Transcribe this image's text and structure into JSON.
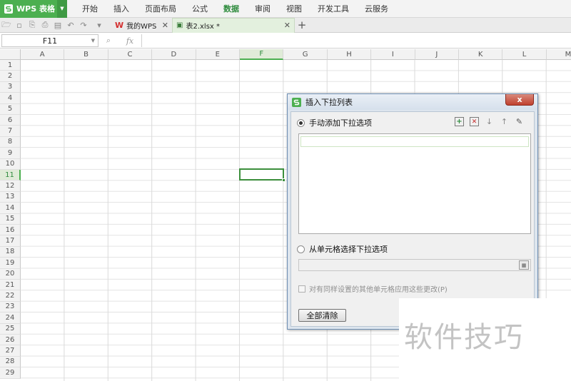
{
  "app": {
    "name": "WPS 表格"
  },
  "menu": [
    "开始",
    "插入",
    "页面布局",
    "公式",
    "数据",
    "审阅",
    "视图",
    "开发工具",
    "云服务"
  ],
  "menu_active": "数据",
  "tabs": {
    "home_label": "我的WPS",
    "doc_label": "表2.xlsx *"
  },
  "formula_bar": {
    "cell_ref": "F11",
    "fx_label": "fx",
    "value": ""
  },
  "grid": {
    "columns": [
      "A",
      "B",
      "C",
      "D",
      "E",
      "F",
      "G",
      "H",
      "I",
      "J",
      "K",
      "L",
      "M"
    ],
    "rows": [
      "1",
      "2",
      "3",
      "4",
      "5",
      "6",
      "7",
      "8",
      "9",
      "10",
      "11",
      "12",
      "13",
      "14",
      "15",
      "16",
      "17",
      "18",
      "19",
      "20",
      "21",
      "22",
      "23",
      "24",
      "25",
      "26",
      "27",
      "28",
      "29"
    ],
    "selected_column": "F",
    "selected_row": "11"
  },
  "dialog": {
    "title": "插入下拉列表",
    "close_label": "x",
    "manual_label": "手动添加下拉选项",
    "manual_selected": true,
    "option_values": [
      ""
    ],
    "range_label": "从单元格选择下拉选项",
    "range_value": "",
    "apply_label": "对有同样设置的其他单元格应用这些更改(P)",
    "apply_checked": false,
    "clear_button": "全部清除"
  },
  "watermark": "软件技巧",
  "colors": {
    "accent": "#4caf50",
    "active_menu": "#2e8b3d",
    "dialog_close": "#c0412f"
  }
}
